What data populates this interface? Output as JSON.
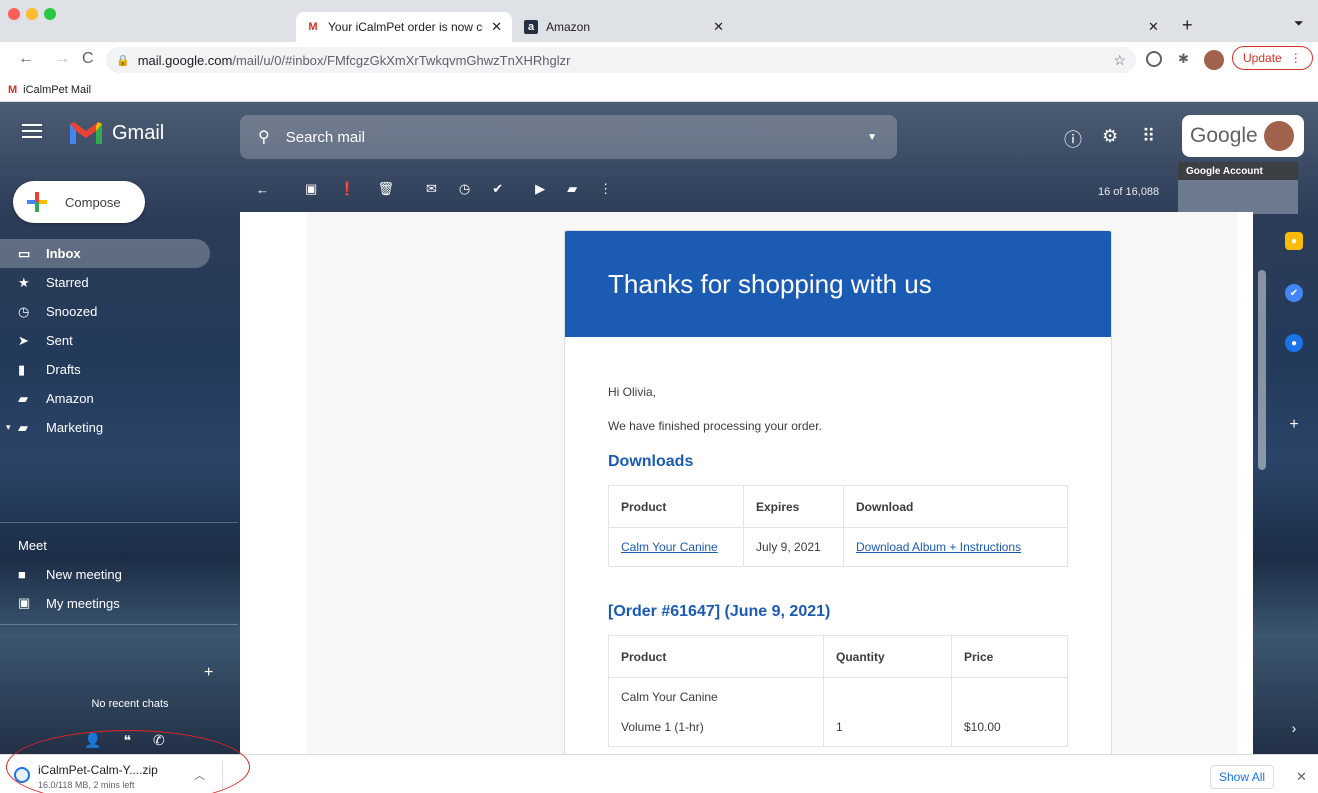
{
  "browser": {
    "tabs": [
      {
        "title": "Your iCalmPet order is now cor",
        "active": true
      },
      {
        "title": "Amazon",
        "active": false
      }
    ],
    "url_host": "mail.google.com",
    "url_path": "/mail/u/0/#inbox/FMfcgzGkXmXrTwkqvmGhwzTnXHRhglzr",
    "bookmark": "iCalmPet Mail",
    "update_label": "Update"
  },
  "gmail": {
    "logo_text": "Gmail",
    "search_placeholder": "Search mail",
    "account_brand": "Google",
    "account_tooltip": "Google Account",
    "compose_label": "Compose",
    "nav": [
      {
        "label": "Inbox",
        "icon": "inbox-icon",
        "selected": true
      },
      {
        "label": "Starred",
        "icon": "star-icon"
      },
      {
        "label": "Snoozed",
        "icon": "clock-icon"
      },
      {
        "label": "Sent",
        "icon": "send-icon"
      },
      {
        "label": "Drafts",
        "icon": "draft-icon"
      },
      {
        "label": "Amazon",
        "icon": "label-icon"
      },
      {
        "label": "Marketing",
        "icon": "label-icon"
      }
    ],
    "meet": {
      "title": "Meet",
      "new_meeting": "New meeting",
      "my_meetings": "My meetings"
    },
    "chat_empty": "No recent chats",
    "page_count": "16 of 16,088"
  },
  "email": {
    "banner": "Thanks for shopping with us",
    "greeting": "Hi Olivia,",
    "intro": "We have finished processing your order.",
    "downloads_heading": "Downloads",
    "downloads_headers": [
      "Product",
      "Expires",
      "Download"
    ],
    "downloads_row": {
      "product": "Calm Your Canine",
      "expires": "July 9, 2021",
      "download": "Download Album + Instructions"
    },
    "order_heading": "[Order #61647] (June 9, 2021)",
    "order_headers": [
      "Product",
      "Quantity",
      "Price"
    ],
    "order_row": {
      "product": "Calm Your Canine",
      "variant": "Volume 1 (1-hr)",
      "quantity": "1",
      "price": "$10.00"
    }
  },
  "download_shelf": {
    "filename": "iCalmPet-Calm-Y....zip",
    "status": "16.0/118 MB, 2 mins left",
    "show_all": "Show All"
  },
  "colors": {
    "email_accent": "#1c5bb4",
    "annotation": "#e22222"
  }
}
